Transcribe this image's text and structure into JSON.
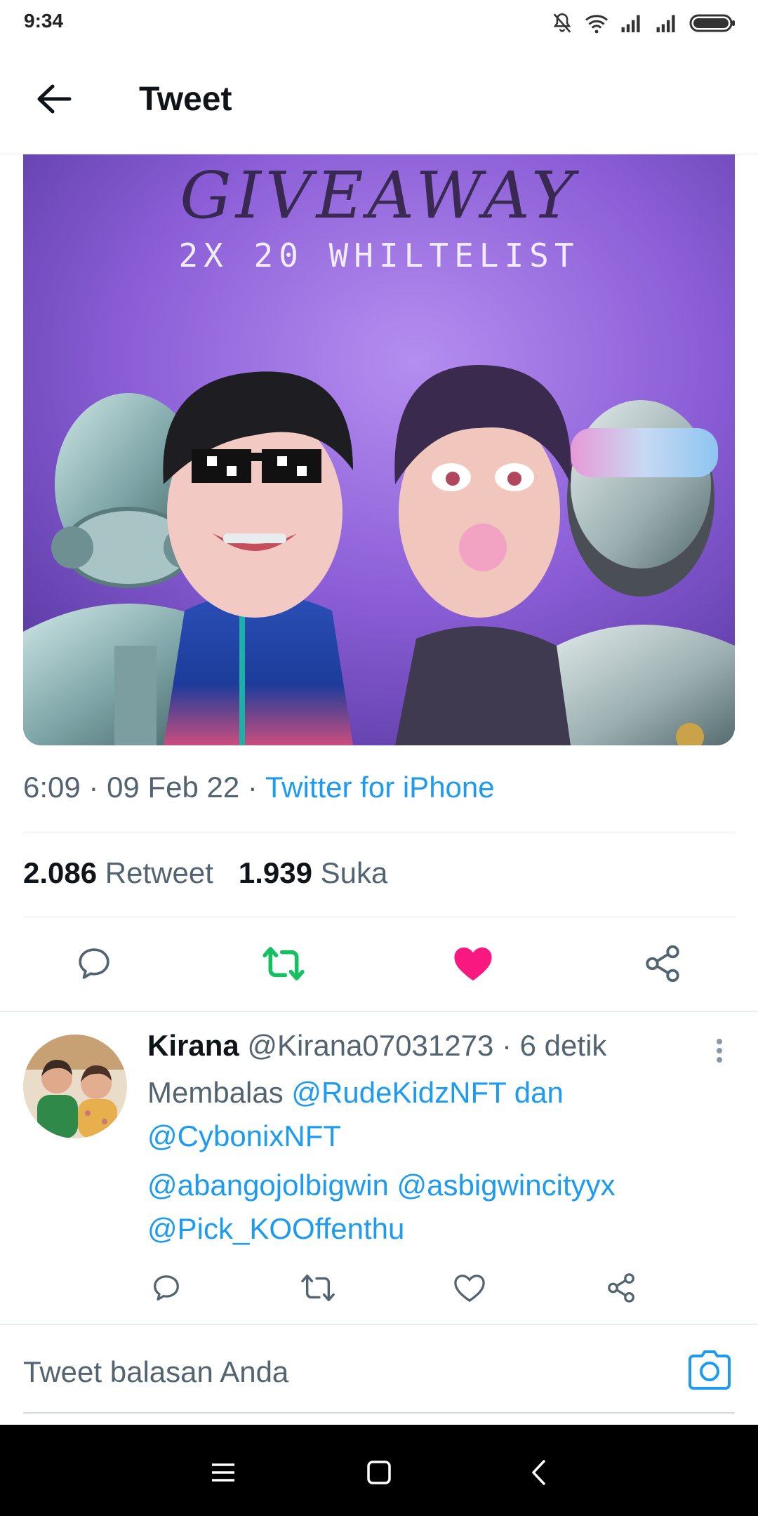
{
  "status_bar": {
    "time": "9:34",
    "icons": [
      "mute-bell-icon",
      "wifi-icon",
      "signal-icon",
      "signal-icon",
      "battery-icon"
    ]
  },
  "header": {
    "title": "Tweet",
    "back_icon": "arrow-left-icon"
  },
  "media": {
    "title_text": "GIVEAWAY",
    "subtitle_text": "2X 20 WHILTELIST",
    "description": "image"
  },
  "tweet_meta": {
    "time": "6:09",
    "date": "09 Feb 22",
    "source": "Twitter for iPhone",
    "separator": " · "
  },
  "stats": {
    "retweet_count": "2.086",
    "retweet_label": "Retweet",
    "like_count": "1.939",
    "like_label": "Suka"
  },
  "actions": {
    "icons": [
      "reply-icon",
      "retweet-icon",
      "like-icon",
      "share-icon"
    ],
    "colors": {
      "retweet": "#17bf63",
      "like": "#f91880",
      "default": "#536471"
    }
  },
  "reply": {
    "name": "Kirana",
    "handle": "@Kirana07031273",
    "time": "6 detik",
    "replying_prefix": "Membalas",
    "replying_to_1": "@RudeKidzNFT",
    "replying_and": "dan",
    "replying_to_2": "@CybonixNFT",
    "mention_1": "@abangojolbigwin",
    "mention_2": "@asbigwincityyx",
    "mention_3": "@Pick_KOOffenthu"
  },
  "composer": {
    "placeholder": "Tweet balasan Anda"
  },
  "theme": {
    "accent": "#1d9bf0",
    "text_secondary": "#536471"
  }
}
